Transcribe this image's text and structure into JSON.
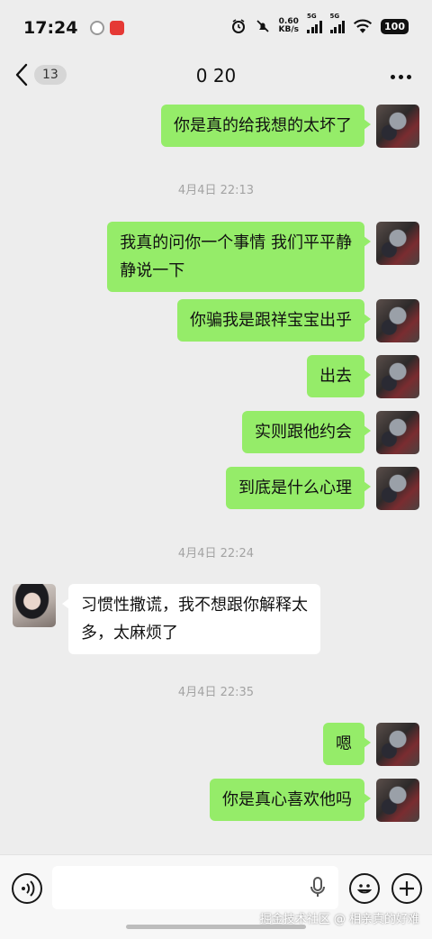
{
  "status_bar": {
    "time": "17:24",
    "net_speed_value": "0.60",
    "net_speed_unit": "KB/s",
    "signal1_label": "5G",
    "signal2_label": "5G",
    "battery": "100"
  },
  "header": {
    "unread_count": "13",
    "title": "0 20"
  },
  "messages": [
    {
      "side": "out",
      "text": "你是真的给我想的太坏了"
    },
    {
      "type": "time",
      "text": "4月4日 22:13"
    },
    {
      "side": "out",
      "text": "我真的问你一个事情 我们平平静\n静说一下"
    },
    {
      "side": "out",
      "text": "你骗我是跟祥宝宝出乎"
    },
    {
      "side": "out",
      "text": "出去"
    },
    {
      "side": "out",
      "text": "实则跟他约会"
    },
    {
      "side": "out",
      "text": "到底是什么心理"
    },
    {
      "type": "time",
      "text": "4月4日 22:24"
    },
    {
      "side": "in",
      "text": "习惯性撒谎，我不想跟你解释太\n多，太麻烦了"
    },
    {
      "type": "time",
      "text": "4月4日 22:35"
    },
    {
      "side": "out",
      "text": "嗯"
    },
    {
      "side": "out",
      "text": "你是真心喜欢他吗"
    }
  ],
  "input_bar": {
    "placeholder": ""
  },
  "watermark": "掘金技术社区 @ 相亲真的好难",
  "colors": {
    "outgoing_bubble": "#95ec69",
    "incoming_bubble": "#ffffff",
    "background": "#ededed"
  }
}
